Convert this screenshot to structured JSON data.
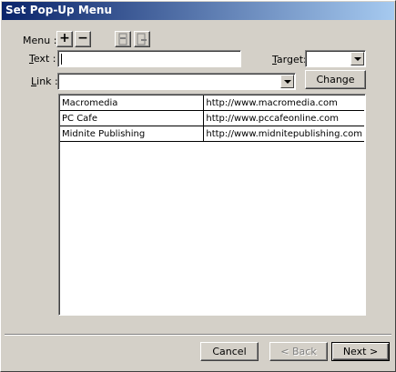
{
  "window": {
    "title": "Set Pop-Up Menu"
  },
  "menu": {
    "label": "Menu :",
    "add_icon": "+",
    "remove_icon": "−"
  },
  "text_field": {
    "label_u": "T",
    "label_rest": "ext :",
    "value": ""
  },
  "target_field": {
    "label_u": "T",
    "label_rest": "arget:",
    "value": ""
  },
  "link_field": {
    "label_u": "L",
    "label_rest": "ink :",
    "value": ""
  },
  "change_button": {
    "label_u": "C",
    "label_rest": "hange"
  },
  "items": [
    {
      "text": "Macromedia",
      "link": "http://www.macromedia.com"
    },
    {
      "text": "PC Cafe",
      "link": "http://www.pccafeonline.com"
    },
    {
      "text": "Midnite Publishing",
      "link": "http://www.midnitepublishing.com"
    }
  ],
  "footer": {
    "cancel": "Cancel",
    "back": "< Back",
    "next": "Next >"
  }
}
